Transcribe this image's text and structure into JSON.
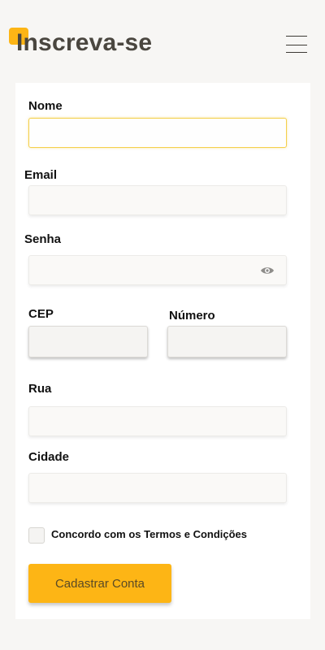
{
  "header": {
    "title": "Inscreva-se",
    "menu_icon": "hamburger-menu-icon"
  },
  "form": {
    "nome_label": "Nome",
    "nome_value": "",
    "email_label": "Email",
    "email_value": "",
    "senha_label": "Senha",
    "senha_value": "",
    "senha_icon": "eye-icon",
    "cep_label": "CEP",
    "cep_value": "",
    "numero_label": "Número",
    "numero_value": "",
    "rua_label": "Rua",
    "rua_value": "",
    "cidade_label": "Cidade",
    "cidade_value": "",
    "terms_label": "Concordo com os Termos e Condições",
    "terms_checked": false,
    "submit_label": "Cadastrar Conta"
  },
  "colors": {
    "accent": "#fdb515",
    "background": "#f7f6f4",
    "card": "#ffffff",
    "title": "#4a463f",
    "focus_border": "#f4cf4b"
  }
}
